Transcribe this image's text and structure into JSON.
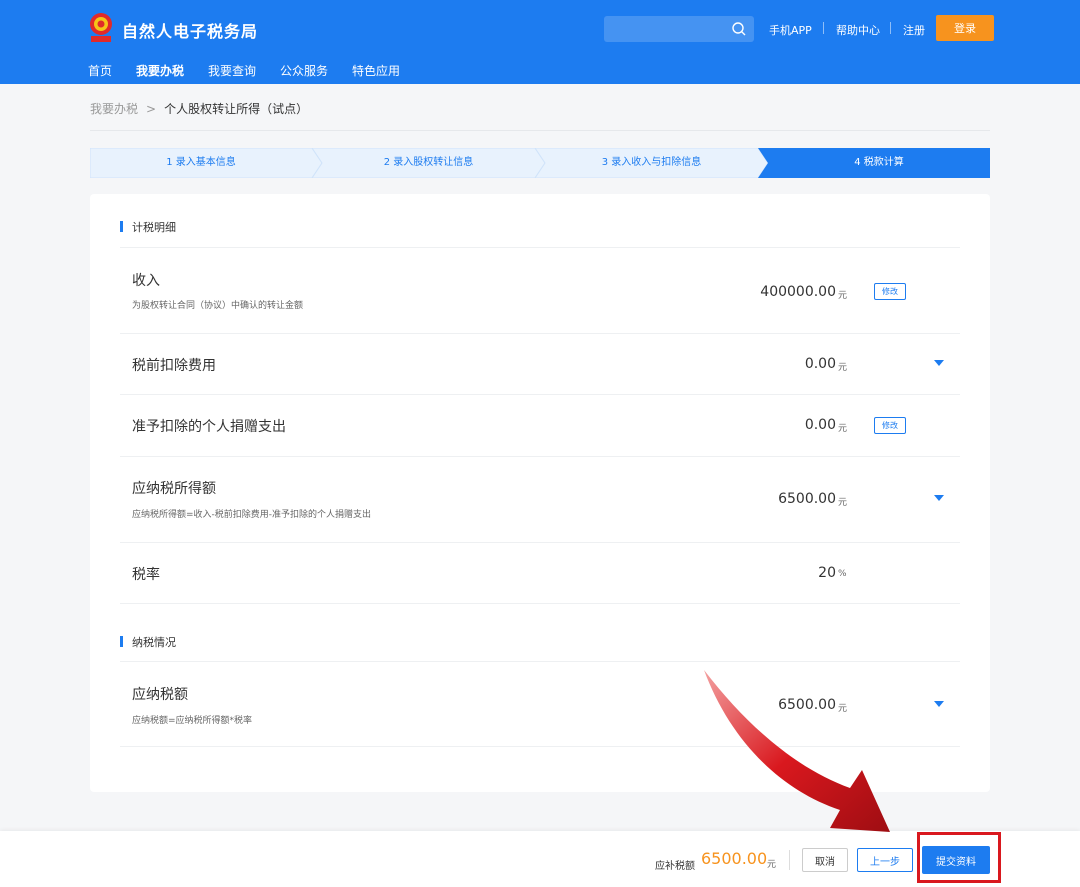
{
  "header": {
    "title": "自然人电子税务局",
    "search": {
      "placeholder": ""
    },
    "links": [
      "手机APP",
      "帮助中心",
      "注册"
    ],
    "login_label": "登录",
    "nav": [
      "首页",
      "我要办税",
      "我要查询",
      "公众服务",
      "特色应用"
    ],
    "active_nav": "我要办税"
  },
  "breadcrumb": {
    "home": "我要办税",
    "separator": ">",
    "current": "个人股权转让所得（试点）"
  },
  "steps": [
    {
      "label": "1  录入基本信息",
      "active": false
    },
    {
      "label": "2  录入股权转让信息",
      "active": false
    },
    {
      "label": "3  录入收入与扣除信息",
      "active": false
    },
    {
      "label": "4  税款计算",
      "active": true
    }
  ],
  "sections": {
    "tax_detail_title": "计税明细",
    "tax_status_title": "纳税情况"
  },
  "rows": [
    {
      "label": "收入",
      "desc": "为股权转让合同（协议）中确认的转让金额",
      "value": "400000.00",
      "unit": "元",
      "action": "修改"
    },
    {
      "label": "税前扣除费用",
      "desc": "",
      "value": "0.00",
      "unit": "元",
      "action": "expand"
    },
    {
      "label": "准予扣除的个人捐赠支出",
      "desc": "",
      "value": "0.00",
      "unit": "元",
      "action": "修改"
    },
    {
      "label": "应纳税所得额",
      "desc": "应纳税所得额=收入-税前扣除费用-准予扣除的个人捐赠支出",
      "value": "6500.00",
      "unit": "元",
      "action": "expand"
    },
    {
      "label": "税率",
      "desc": "",
      "value": "20",
      "unit": "%",
      "action": ""
    },
    {
      "label": "应纳税额",
      "desc": "应纳税额=应纳税所得额*税率",
      "value": "6500.00",
      "unit": "元",
      "action": "expand"
    }
  ],
  "footer": {
    "tax_label": "应补税额",
    "tax_amount": "6500.00",
    "tax_unit": "元",
    "cancel_label": "取消",
    "prev_label": "上一步",
    "submit_label": "提交资料"
  },
  "colors": {
    "primary": "#1d7cf0",
    "accent": "#f7931e",
    "annotation": "#d9181e"
  }
}
